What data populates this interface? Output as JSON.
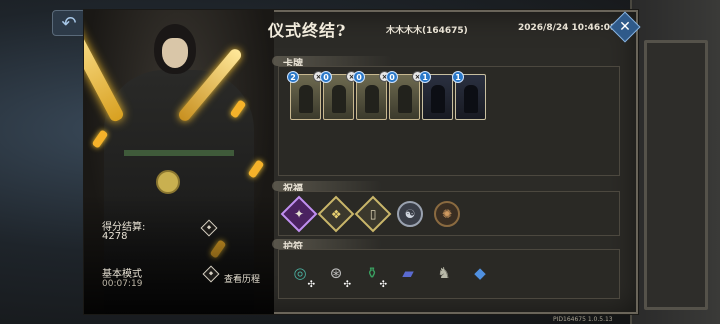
{
  "header": {
    "title": "仪式终结?",
    "player": "木木木木(164675)",
    "datetime": "2026/8/24 10:46:08"
  },
  "buttons": {
    "back_icon": "undo-arrow-icon",
    "close_icon": "close-x-icon"
  },
  "character": {
    "score_label": "得分结算:",
    "score_value": "4278",
    "mode_label": "基本模式",
    "mode_time": "00:07:19",
    "history_label": "查看历程"
  },
  "sections": {
    "cards_title": "卡牌",
    "blessings_title": "祝福",
    "charms_title": "护符"
  },
  "cards": [
    {
      "cost": "2",
      "style": "light"
    },
    {
      "cost": "0",
      "style": "light"
    },
    {
      "cost": "0",
      "style": "light"
    },
    {
      "cost": "0",
      "style": "light"
    },
    {
      "cost": "1",
      "style": "dark"
    },
    {
      "cost": "1",
      "style": "dark"
    }
  ],
  "blessings": [
    {
      "icon": "purple-crystal-icon"
    },
    {
      "icon": "gold-swirl-icon"
    },
    {
      "icon": "scroll-card-icon"
    },
    {
      "icon": "silver-beast-icon"
    },
    {
      "icon": "bronze-beast-icon"
    }
  ],
  "charms": [
    {
      "icon": "green-ring-icon"
    },
    {
      "icon": "prayer-beads-icon"
    },
    {
      "icon": "jade-bottle-icon"
    },
    {
      "icon": "blue-book-icon"
    },
    {
      "icon": "ghost-horse-icon"
    },
    {
      "icon": "blue-crystal-icon"
    }
  ],
  "footer": {
    "build_id": "PID164675  1.0.5.13"
  },
  "colors": {
    "accent_gold": "#c9b66a",
    "cost_blue": "#2a78c8",
    "close_blue": "#2f5a8a"
  }
}
